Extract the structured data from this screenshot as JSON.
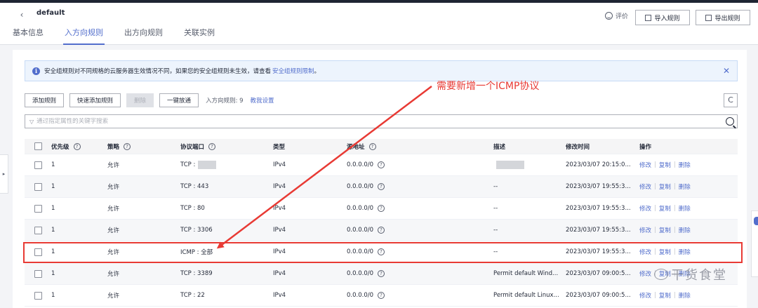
{
  "header": {
    "title": "default",
    "back_icon": "‹",
    "rate_label": "评价",
    "import_label": "导入规则",
    "export_label": "导出规则",
    "tabs": [
      {
        "label": "基本信息",
        "active": false
      },
      {
        "label": "入方向规则",
        "active": true
      },
      {
        "label": "出方向规则",
        "active": false
      },
      {
        "label": "关联实例",
        "active": false
      }
    ]
  },
  "notice": {
    "text": "安全组规则对不同规格的云服务器生效情况不同，如果您的安全组规则未生效，请查看",
    "link": "安全组规则限制",
    "suffix": "。",
    "close": "✕"
  },
  "toolbar": {
    "add_rule": "添加规则",
    "quick_add": "快速添加规则",
    "delete": "删除",
    "one_click": "一键放通",
    "rule_count": "入方向规则: 9",
    "help": "教我设置",
    "refresh": "C"
  },
  "search": {
    "placeholder": "通过指定属性的关键字搜索"
  },
  "table": {
    "columns": {
      "priority": "优先级",
      "policy": "策略",
      "protocol_port": "协议端口",
      "type": "类型",
      "source": "源地址",
      "desc": "描述",
      "modified": "修改时间",
      "actions": "操作"
    },
    "q_mark": "?",
    "actions": {
      "edit": "修改",
      "copy": "复制",
      "delete": "删除",
      "sep": "|"
    },
    "rows": [
      {
        "priority": "1",
        "policy": "允许",
        "port": "TCP :",
        "type": "IPv4",
        "source": "0.0.0.0/0",
        "desc": "",
        "modified": "2023/03/07 20:15:0..."
      },
      {
        "priority": "1",
        "policy": "允许",
        "port": "TCP : 443",
        "type": "IPv4",
        "source": "0.0.0.0/0",
        "desc": "--",
        "modified": "2023/03/07 19:55:3..."
      },
      {
        "priority": "1",
        "policy": "允许",
        "port": "TCP : 80",
        "type": "IPv4",
        "source": "0.0.0.0/0",
        "desc": "--",
        "modified": "2023/03/07 19:55:3..."
      },
      {
        "priority": "1",
        "policy": "允许",
        "port": "TCP : 3306",
        "type": "IPv4",
        "source": "0.0.0.0/0",
        "desc": "--",
        "modified": "2023/03/07 19:55:3..."
      },
      {
        "priority": "1",
        "policy": "允许",
        "port": "ICMP : 全部",
        "type": "IPv4",
        "source": "0.0.0.0/0",
        "desc": "--",
        "modified": "2023/03/07 19:55:3..."
      },
      {
        "priority": "1",
        "policy": "允许",
        "port": "TCP : 3389",
        "type": "IPv4",
        "source": "0.0.0.0/0",
        "desc": "Permit default Wind...",
        "modified": "2023/03/07 09:00:5..."
      },
      {
        "priority": "1",
        "policy": "允许",
        "port": "TCP : 22",
        "type": "IPv4",
        "source": "0.0.0.0/0",
        "desc": "Permit default Linux...",
        "modified": "2023/03/07 09:00:5..."
      }
    ]
  },
  "annotation": {
    "text": "需要新增一个ICMP协议",
    "color": "#e83a34"
  },
  "watermark": "干货食堂",
  "colors": {
    "accent": "#526ecc",
    "annotation": "#e83a34"
  }
}
